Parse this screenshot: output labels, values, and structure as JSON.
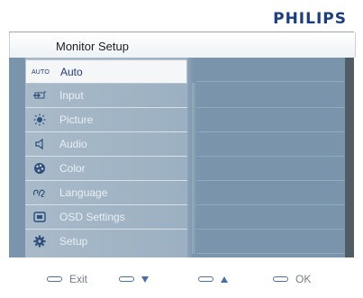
{
  "brand": "PHILIPS",
  "title": "Monitor Setup",
  "menu": {
    "items": [
      {
        "label": "Auto",
        "icon": "auto-icon",
        "icon_text": "AUTO",
        "selected": true
      },
      {
        "label": "Input",
        "icon": "input-icon"
      },
      {
        "label": "Picture",
        "icon": "picture-icon"
      },
      {
        "label": "Audio",
        "icon": "speaker-icon"
      },
      {
        "label": "Color",
        "icon": "palette-icon"
      },
      {
        "label": "Language",
        "icon": "language-icon"
      },
      {
        "label": "OSD Settings",
        "icon": "osd-settings-icon"
      },
      {
        "label": "Setup",
        "icon": "gear-icon"
      }
    ]
  },
  "footer": {
    "exit_label": "Exit",
    "ok_label": "OK"
  },
  "colors": {
    "brand": "#1b3e82",
    "panel": "#7a94ab",
    "menu": "#a9bac9",
    "selected": "#f4f6f8",
    "key_accent": "#4a6ea8"
  }
}
